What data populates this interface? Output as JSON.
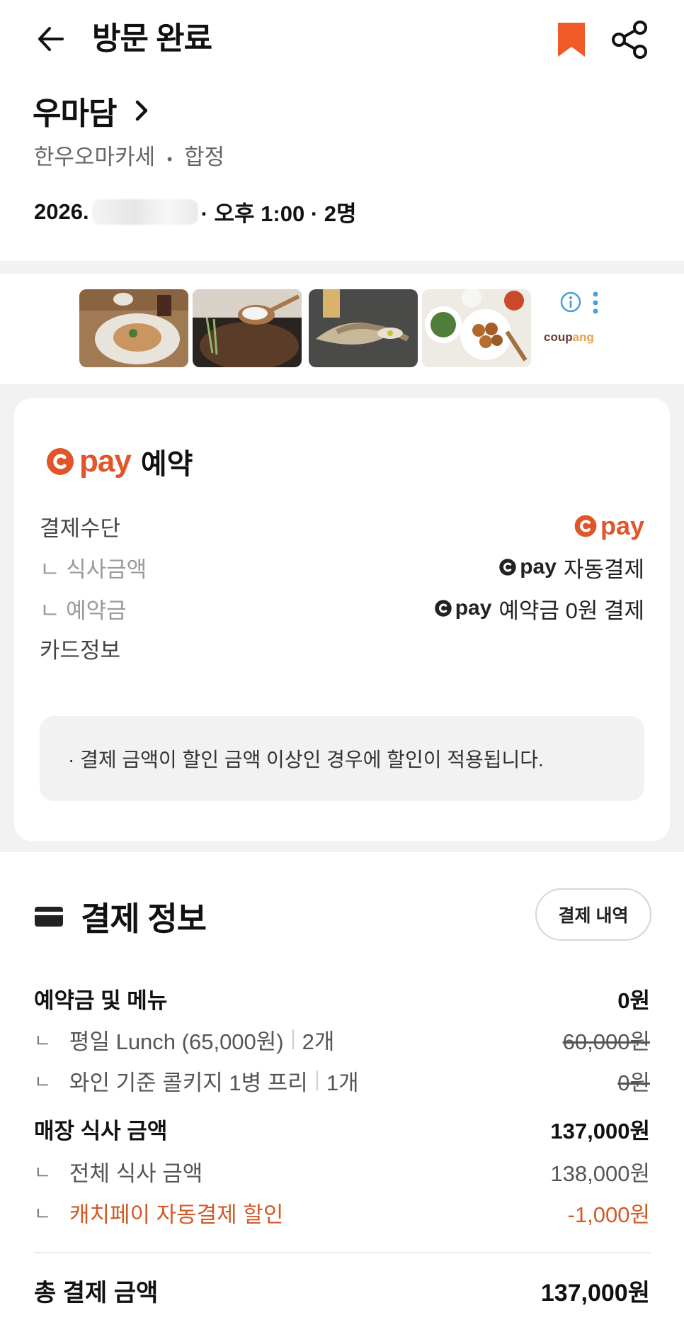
{
  "header": {
    "title": "방문 완료"
  },
  "restaurant": {
    "name": "우마담",
    "category": "한우오마카세",
    "location": "합정",
    "separator": "•",
    "visit_date": "2026.",
    "visit_rest": "· 오후 1:00 · 2명"
  },
  "ad": {
    "brand": "coupang",
    "brand_color_1": "#6b3a2a",
    "brand_color_2": "#e8a24a"
  },
  "cpay_section": {
    "brand": "pay",
    "title": "예약",
    "rows": [
      {
        "label": "결제수단",
        "value_text": ""
      },
      {
        "label": "ㄴ 식사금액",
        "value_text": "자동결제",
        "brand": "pay"
      },
      {
        "label": "ㄴ 예약금",
        "value_text": "예약금 0원 결제",
        "brand": "pay"
      },
      {
        "label": "카드정보",
        "value_text": ""
      }
    ],
    "notice": "·  결제 금액이 할인 금액 이상인 경우에 할인이 적용됩니다."
  },
  "payment_info": {
    "title": "결제 정보",
    "history_button": "결제 내역",
    "items": [
      {
        "label": "예약금 및 메뉴",
        "value": "0원"
      },
      {
        "label": "평일 Lunch (65,000원)",
        "qty": "2개",
        "value": "60,000원"
      },
      {
        "label": "와인 기준 콜키지 1병 프리",
        "qty": "1개",
        "value": "0원"
      },
      {
        "label": "매장 식사 금액",
        "value": "137,000원"
      },
      {
        "label": "전체 식사 금액",
        "value": "138,000원"
      },
      {
        "label": "캐치페이 자동결제 할인",
        "value": "-1,000원"
      }
    ],
    "total_label": "총 결제 금액",
    "total_value": "137,000원",
    "corner_glyph": "ㄴ"
  },
  "colors": {
    "accent": "#e0552a",
    "discount": "#d15a27",
    "bookmark": "#f05a28"
  }
}
